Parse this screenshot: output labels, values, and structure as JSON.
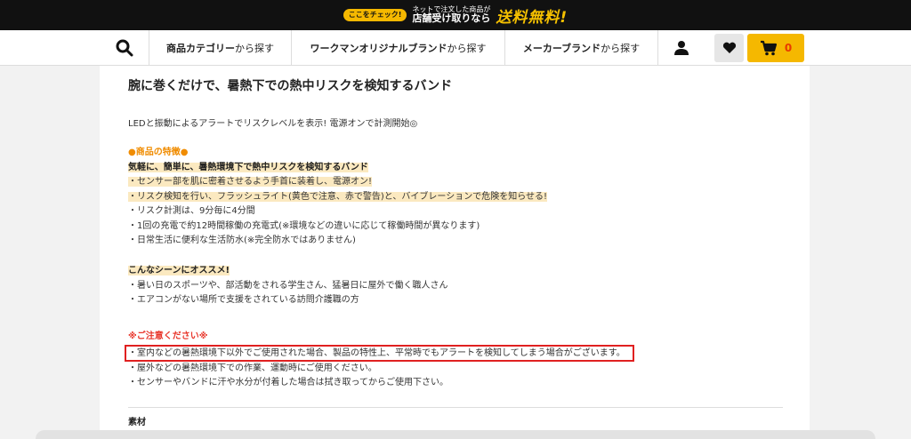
{
  "promo": {
    "badge": "ここをチェック!",
    "line1": "ネットで注文した商品が",
    "line2": "店舗受け取りなら",
    "free": "送料無料!"
  },
  "nav": {
    "categories": [
      {
        "bold": "商品カテゴリー",
        "suffix": "から探す"
      },
      {
        "bold": "ワークマンオリジナルブランド",
        "suffix": "から探す"
      },
      {
        "bold": "メーカーブランド",
        "suffix": "から探す"
      }
    ],
    "cart_count": "0",
    "accent": "#f5b800"
  },
  "product": {
    "title": "腕に巻くだけで、暑熱下での熱中リスクを検知するバンド",
    "lead": "LEDと振動によるアラートでリスクレベルを表示! 電源オンで計測開始◎",
    "features_heading": "●商品の特徴●",
    "features_subheading": "気軽に、簡単に、暑熱環境下で熱中リスクを検知するバンド",
    "features": [
      "・センサー部を肌に密着させるよう手首に装着し、電源オン!",
      "・リスク検知を行い、フラッシュライト(黄色で注意、赤で警告)と、バイブレーションで危険を知らせる!",
      "・リスク計測は、9分毎に4分間",
      "・1回の充電で約12時間稼働の充電式(※環境などの違いに応じて稼働時間が異なります)",
      "・日常生活に便利な生活防水(※完全防水ではありません)"
    ],
    "scene_heading": "こんなシーンにオススメ!",
    "scenes": [
      "・暑い日のスポーツや、部活動をされる学生さん、猛暑日に屋外で働く職人さん",
      "・エアコンがない場所で支援をされている訪問介護職の方"
    ],
    "caution_heading": "※ご注意ください※",
    "cautions": [
      "・室内などの暑熱環境下以外でご使用された場合、製品の特性上、平常時でもアラートを検知してしまう場合がございます。",
      "・屋外などの暑熱環境下での作業、運動時にご使用ください。",
      "・センサーやバンドに汗や水分が付着した場合は拭き取ってからご使用下さい。"
    ],
    "material_label": "素材"
  }
}
